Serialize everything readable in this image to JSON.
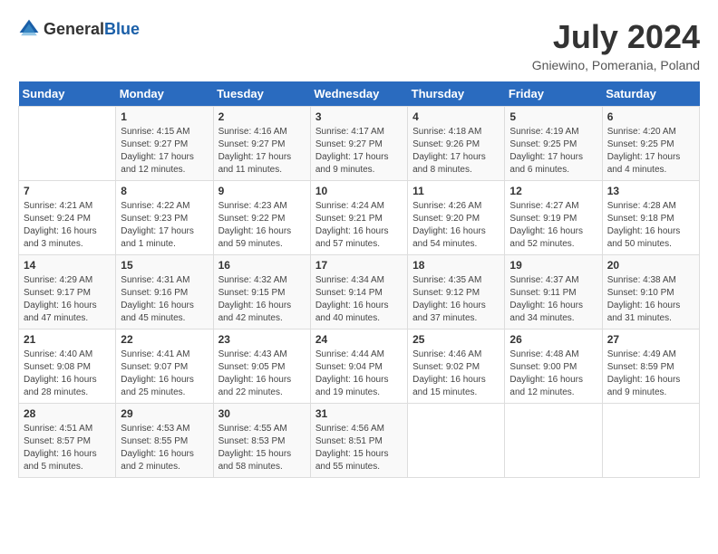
{
  "header": {
    "logo_general": "General",
    "logo_blue": "Blue",
    "month_year": "July 2024",
    "location": "Gniewino, Pomerania, Poland"
  },
  "days_of_week": [
    "Sunday",
    "Monday",
    "Tuesday",
    "Wednesday",
    "Thursday",
    "Friday",
    "Saturday"
  ],
  "weeks": [
    [
      {
        "day": "",
        "sunrise": "",
        "sunset": "",
        "daylight": ""
      },
      {
        "day": "1",
        "sunrise": "4:15 AM",
        "sunset": "9:27 PM",
        "daylight": "17 hours and 12 minutes."
      },
      {
        "day": "2",
        "sunrise": "4:16 AM",
        "sunset": "9:27 PM",
        "daylight": "17 hours and 11 minutes."
      },
      {
        "day": "3",
        "sunrise": "4:17 AM",
        "sunset": "9:27 PM",
        "daylight": "17 hours and 9 minutes."
      },
      {
        "day": "4",
        "sunrise": "4:18 AM",
        "sunset": "9:26 PM",
        "daylight": "17 hours and 8 minutes."
      },
      {
        "day": "5",
        "sunrise": "4:19 AM",
        "sunset": "9:25 PM",
        "daylight": "17 hours and 6 minutes."
      },
      {
        "day": "6",
        "sunrise": "4:20 AM",
        "sunset": "9:25 PM",
        "daylight": "17 hours and 4 minutes."
      }
    ],
    [
      {
        "day": "7",
        "sunrise": "4:21 AM",
        "sunset": "9:24 PM",
        "daylight": "16 hours and 3 minutes."
      },
      {
        "day": "8",
        "sunrise": "4:22 AM",
        "sunset": "9:23 PM",
        "daylight": "17 hours and 1 minute."
      },
      {
        "day": "9",
        "sunrise": "4:23 AM",
        "sunset": "9:22 PM",
        "daylight": "16 hours and 59 minutes."
      },
      {
        "day": "10",
        "sunrise": "4:24 AM",
        "sunset": "9:21 PM",
        "daylight": "16 hours and 57 minutes."
      },
      {
        "day": "11",
        "sunrise": "4:26 AM",
        "sunset": "9:20 PM",
        "daylight": "16 hours and 54 minutes."
      },
      {
        "day": "12",
        "sunrise": "4:27 AM",
        "sunset": "9:19 PM",
        "daylight": "16 hours and 52 minutes."
      },
      {
        "day": "13",
        "sunrise": "4:28 AM",
        "sunset": "9:18 PM",
        "daylight": "16 hours and 50 minutes."
      }
    ],
    [
      {
        "day": "14",
        "sunrise": "4:29 AM",
        "sunset": "9:17 PM",
        "daylight": "16 hours and 47 minutes."
      },
      {
        "day": "15",
        "sunrise": "4:31 AM",
        "sunset": "9:16 PM",
        "daylight": "16 hours and 45 minutes."
      },
      {
        "day": "16",
        "sunrise": "4:32 AM",
        "sunset": "9:15 PM",
        "daylight": "16 hours and 42 minutes."
      },
      {
        "day": "17",
        "sunrise": "4:34 AM",
        "sunset": "9:14 PM",
        "daylight": "16 hours and 40 minutes."
      },
      {
        "day": "18",
        "sunrise": "4:35 AM",
        "sunset": "9:12 PM",
        "daylight": "16 hours and 37 minutes."
      },
      {
        "day": "19",
        "sunrise": "4:37 AM",
        "sunset": "9:11 PM",
        "daylight": "16 hours and 34 minutes."
      },
      {
        "day": "20",
        "sunrise": "4:38 AM",
        "sunset": "9:10 PM",
        "daylight": "16 hours and 31 minutes."
      }
    ],
    [
      {
        "day": "21",
        "sunrise": "4:40 AM",
        "sunset": "9:08 PM",
        "daylight": "16 hours and 28 minutes."
      },
      {
        "day": "22",
        "sunrise": "4:41 AM",
        "sunset": "9:07 PM",
        "daylight": "16 hours and 25 minutes."
      },
      {
        "day": "23",
        "sunrise": "4:43 AM",
        "sunset": "9:05 PM",
        "daylight": "16 hours and 22 minutes."
      },
      {
        "day": "24",
        "sunrise": "4:44 AM",
        "sunset": "9:04 PM",
        "daylight": "16 hours and 19 minutes."
      },
      {
        "day": "25",
        "sunrise": "4:46 AM",
        "sunset": "9:02 PM",
        "daylight": "16 hours and 15 minutes."
      },
      {
        "day": "26",
        "sunrise": "4:48 AM",
        "sunset": "9:00 PM",
        "daylight": "16 hours and 12 minutes."
      },
      {
        "day": "27",
        "sunrise": "4:49 AM",
        "sunset": "8:59 PM",
        "daylight": "16 hours and 9 minutes."
      }
    ],
    [
      {
        "day": "28",
        "sunrise": "4:51 AM",
        "sunset": "8:57 PM",
        "daylight": "16 hours and 5 minutes."
      },
      {
        "day": "29",
        "sunrise": "4:53 AM",
        "sunset": "8:55 PM",
        "daylight": "16 hours and 2 minutes."
      },
      {
        "day": "30",
        "sunrise": "4:55 AM",
        "sunset": "8:53 PM",
        "daylight": "15 hours and 58 minutes."
      },
      {
        "day": "31",
        "sunrise": "4:56 AM",
        "sunset": "8:51 PM",
        "daylight": "15 hours and 55 minutes."
      },
      {
        "day": "",
        "sunrise": "",
        "sunset": "",
        "daylight": ""
      },
      {
        "day": "",
        "sunrise": "",
        "sunset": "",
        "daylight": ""
      },
      {
        "day": "",
        "sunrise": "",
        "sunset": "",
        "daylight": ""
      }
    ]
  ]
}
